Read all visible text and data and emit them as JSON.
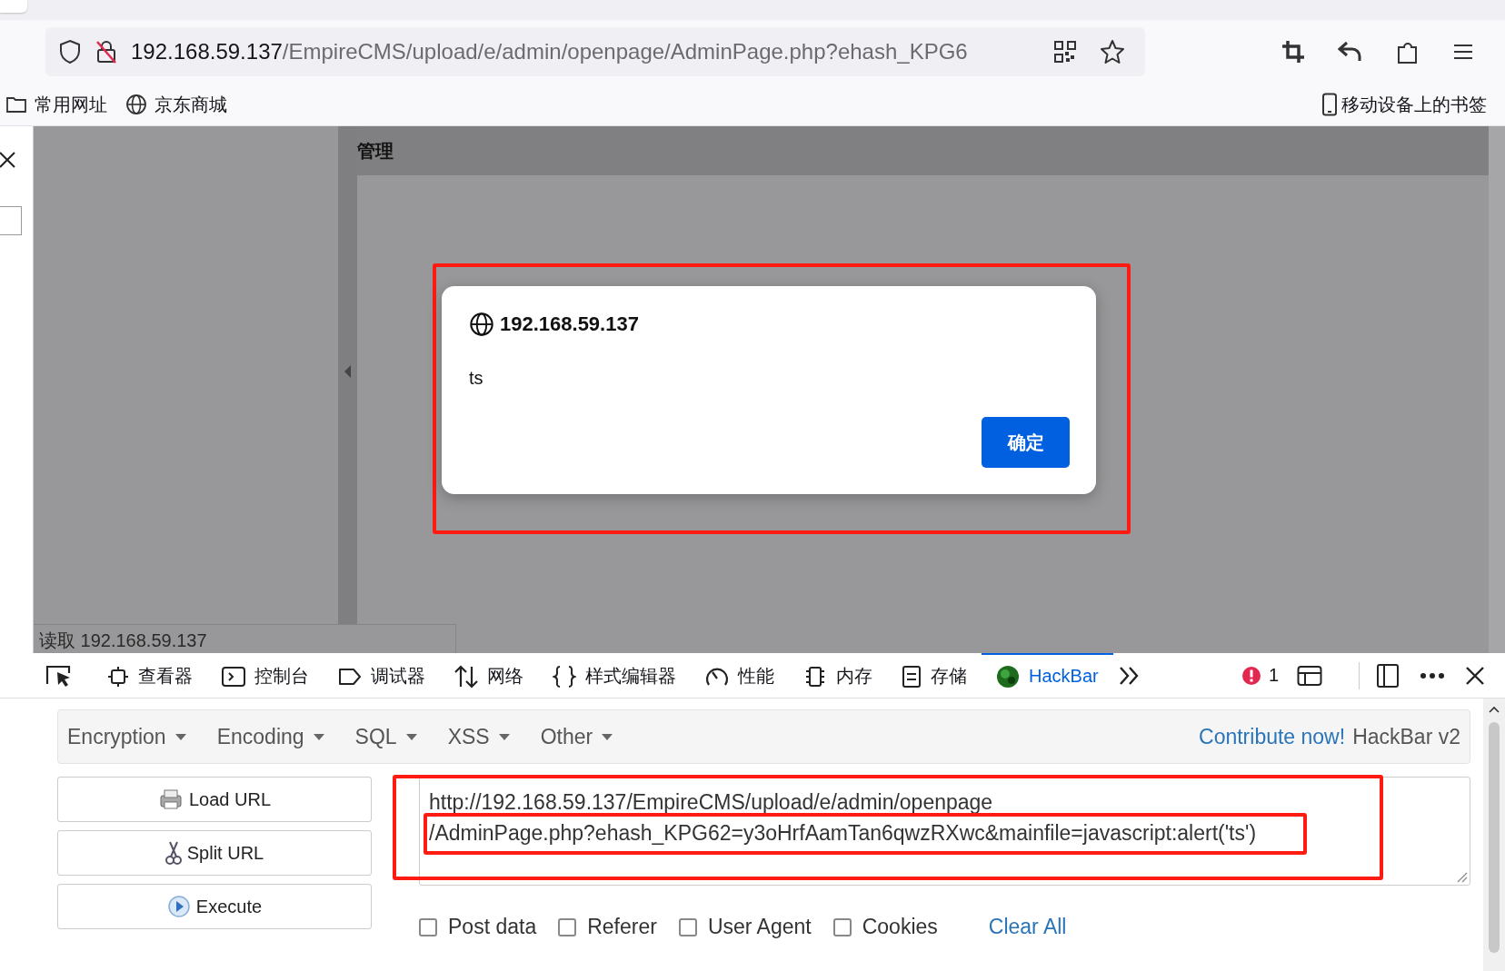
{
  "browser": {
    "url_host": "192.168.59.137",
    "url_path": "/EmpireCMS/upload/e/admin/openpage/AdminPage.php?ehash_KPG6",
    "bookmarks": [
      {
        "label": "常用网址",
        "kind": "folder"
      },
      {
        "label": "京东商城",
        "kind": "globe"
      }
    ],
    "mobile_bookmarks": "移动设备上的书签"
  },
  "page": {
    "header": "管理",
    "status": "读取 192.168.59.137"
  },
  "dialog": {
    "origin": "192.168.59.137",
    "message": "ts",
    "button": "确定"
  },
  "devtools": {
    "tabs": [
      {
        "label": "查看器",
        "kind": "inspector",
        "selected": false
      },
      {
        "label": "控制台",
        "kind": "console",
        "selected": false
      },
      {
        "label": "调试器",
        "kind": "debugger",
        "selected": false
      },
      {
        "label": "网络",
        "kind": "network",
        "selected": false
      },
      {
        "label": "样式编辑器",
        "kind": "style",
        "selected": false
      },
      {
        "label": "性能",
        "kind": "performance",
        "selected": false
      },
      {
        "label": "内存",
        "kind": "memory",
        "selected": false
      },
      {
        "label": "存储",
        "kind": "storage",
        "selected": false
      },
      {
        "label": "HackBar",
        "kind": "hackbar",
        "selected": true
      }
    ],
    "error_count": "1"
  },
  "hackbar": {
    "menus": [
      "Encryption",
      "Encoding",
      "SQL",
      "XSS",
      "Other"
    ],
    "contribute_link": "Contribute now!",
    "version": "HackBar v2",
    "actions": [
      {
        "label": "Load URL",
        "kind": "load"
      },
      {
        "label": "Split URL",
        "kind": "split"
      },
      {
        "label": "Execute",
        "kind": "execute"
      }
    ],
    "url_lines": [
      "http://192.168.59.137/EmpireCMS/upload/e/admin/openpage",
      "/AdminPage.php?ehash_KPG62=y3oHrfAamTan6qwzRXwc&mainfile=javascript:alert('ts')"
    ],
    "options": [
      {
        "label": "Post data",
        "checked": false
      },
      {
        "label": "Referer",
        "checked": false
      },
      {
        "label": "User Agent",
        "checked": false
      },
      {
        "label": "Cookies",
        "checked": false
      }
    ],
    "clear_all": "Clear All"
  }
}
